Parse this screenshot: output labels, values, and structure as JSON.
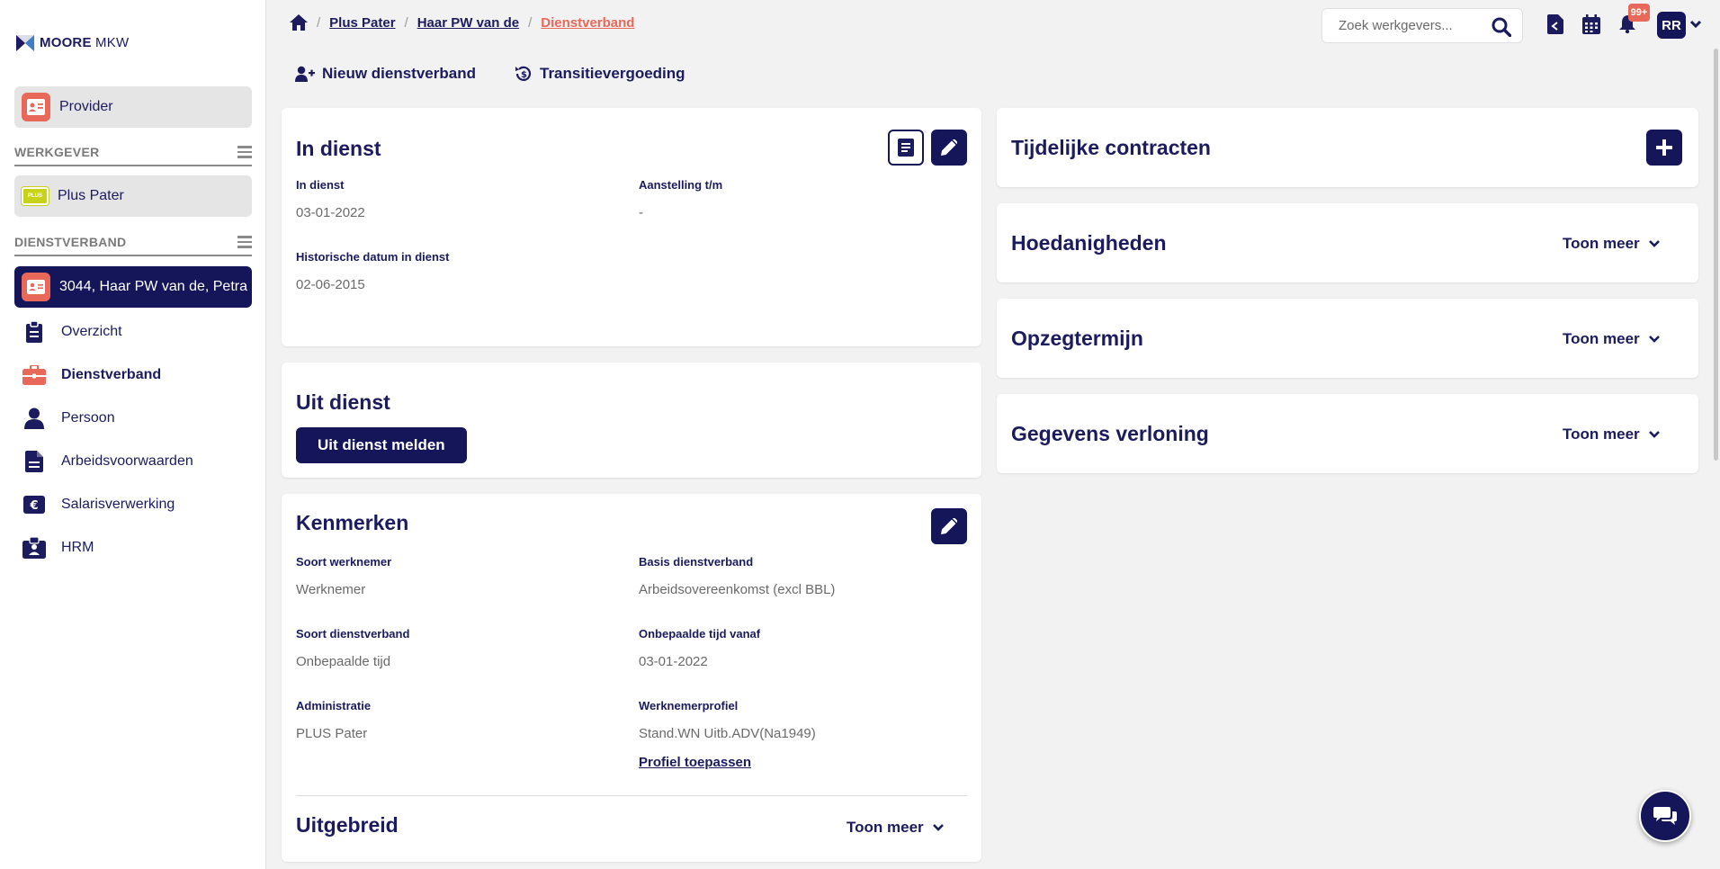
{
  "brand": {
    "name_bold": "MOORE",
    "name_light": "MKW"
  },
  "sidebar": {
    "provider_label": "Provider",
    "werkgever_section": "WERKGEVER",
    "werkgever_name": "Plus Pater",
    "werkgever_logo_text": "PLUS",
    "dienstverband_section": "DIENSTVERBAND",
    "dienstverband_active": "3044, Haar PW van de, Petra",
    "items": [
      {
        "label": "Overzicht",
        "icon": "clipboard-icon"
      },
      {
        "label": "Dienstverband",
        "icon": "briefcase-icon"
      },
      {
        "label": "Persoon",
        "icon": "person-icon"
      },
      {
        "label": "Arbeidsvoorwaarden",
        "icon": "document-icon"
      },
      {
        "label": "Salarisverwerking",
        "icon": "euro-icon"
      },
      {
        "label": "HRM",
        "icon": "id-card-icon"
      }
    ]
  },
  "breadcrumb": {
    "items": [
      "Plus Pater",
      "Haar PW van de",
      "Dienstverband"
    ],
    "separator": "/"
  },
  "header": {
    "search_placeholder": "Zoek werkgevers...",
    "notification_count": "99+",
    "user_initials": "RR"
  },
  "actions": {
    "new_label": "Nieuw dienstverband",
    "transition_label": "Transitievergoeding"
  },
  "in_dienst": {
    "title": "In dienst",
    "fields": [
      {
        "label": "In dienst",
        "value": "03-01-2022"
      },
      {
        "label": "Aanstelling t/m",
        "value": "-"
      },
      {
        "label": "Historische datum in dienst",
        "value": "02-06-2015"
      }
    ]
  },
  "uit_dienst": {
    "title": "Uit dienst",
    "button": "Uit dienst melden"
  },
  "kenmerken": {
    "title": "Kenmerken",
    "fields": [
      {
        "label": "Soort werknemer",
        "value": "Werknemer"
      },
      {
        "label": "Basis dienstverband",
        "value": "Arbeidsovereenkomst (excl BBL)"
      },
      {
        "label": "Soort dienstverband",
        "value": "Onbepaalde tijd"
      },
      {
        "label": "Onbepaalde tijd vanaf",
        "value": "03-01-2022"
      },
      {
        "label": "Administratie",
        "value": "PLUS Pater"
      },
      {
        "label": "Werknemerprofiel",
        "value": "Stand.WN Uitb.ADV(Na1949)"
      }
    ],
    "profile_link": "Profiel toepassen",
    "extended_title": "Uitgebreid",
    "extended_toggle": "Toon meer"
  },
  "right_panels": {
    "tijdelijke": "Tijdelijke contracten",
    "hoedanigheden": "Hoedanigheden",
    "opzegtermijn": "Opzegtermijn",
    "verloning": "Gegevens verloning",
    "toggle": "Toon meer"
  },
  "colors": {
    "primary": "#15155a",
    "accent": "#e8685a",
    "background": "#f2f2f2"
  }
}
